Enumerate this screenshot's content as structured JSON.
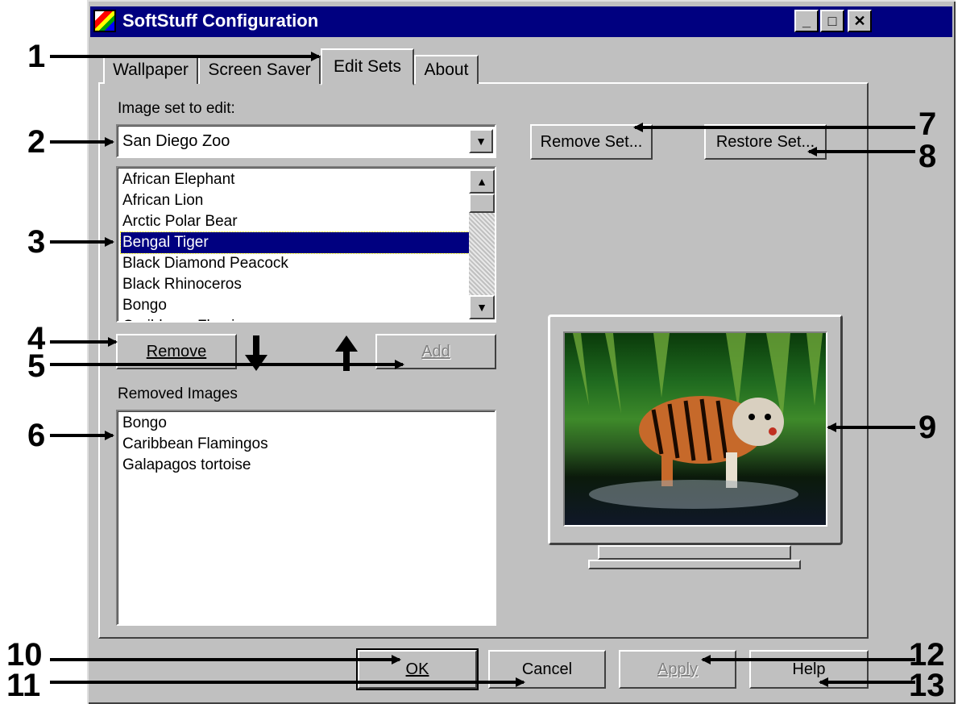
{
  "window": {
    "title": "SoftStuff Configuration",
    "minimize_glyph": "_",
    "maximize_glyph": "□",
    "close_glyph": "✕"
  },
  "tabs": [
    {
      "label": "Wallpaper"
    },
    {
      "label": "Screen Saver"
    },
    {
      "label": "Edit Sets",
      "active": true
    },
    {
      "label": "About"
    }
  ],
  "edit_sets": {
    "image_set_label": "Image set to edit:",
    "image_set_value": "San Diego Zoo",
    "remove_set_label": "Remove Set...",
    "restore_set_label": "Restore Set...",
    "images": [
      "African Elephant",
      "African Lion",
      "Arctic Polar Bear",
      "Bengal Tiger",
      "Black Diamond Peacock",
      "Black Rhinoceros",
      "Bongo",
      "Caribbean Flamingos"
    ],
    "selected_image": "Bengal Tiger",
    "remove_label": "Remove",
    "add_label": "Add",
    "removed_label": "Removed Images",
    "removed_images": [
      "Bongo",
      "Caribbean Flamingos",
      "Galapagos tortoise"
    ],
    "preview_image": "bengal-tiger-photo"
  },
  "footer": {
    "ok_label": "OK",
    "cancel_label": "Cancel",
    "apply_label": "Apply",
    "help_label": "Help"
  },
  "callouts": [
    "1",
    "2",
    "3",
    "4",
    "5",
    "6",
    "7",
    "8",
    "9",
    "10",
    "11",
    "12",
    "13"
  ],
  "colors": {
    "titlebar": "#000080",
    "dialog": "#c0c0c0",
    "selection": "#000080"
  }
}
